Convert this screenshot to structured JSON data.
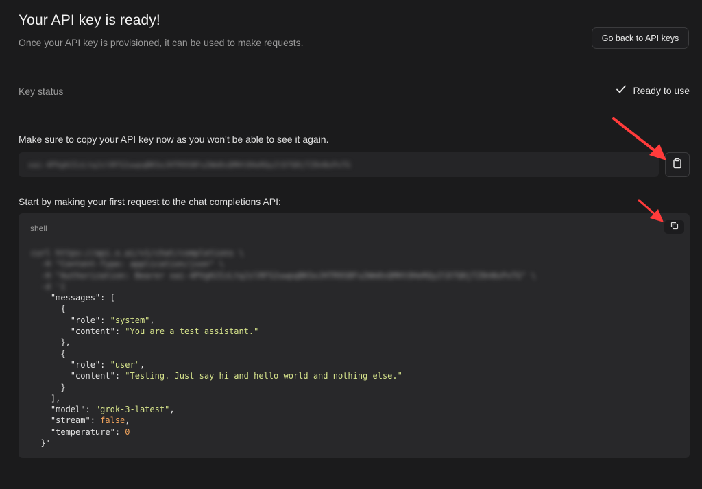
{
  "header": {
    "title": "Your API key is ready!",
    "subtitle": "Once your API key is provisioned, it can be used to make requests.",
    "back_button": "Go back to API keys"
  },
  "status": {
    "label": "Key status",
    "value": "Ready to use",
    "icon": "check-icon"
  },
  "key_section": {
    "notice": "Make sure to copy your API key now as you won't be able to see it again.",
    "key_value_obscured": "xai-4PVgHJIzLtqJzlRFS2uwpqBKSoJHTR9SBFu2Wm8sQMHtOHeRQy2lD7Q0jTZ0nNsPxTG",
    "copy_icon": "clipboard-icon"
  },
  "request_section": {
    "intro": "Start by making your first request to the chat completions API:",
    "language": "shell",
    "copy_icon": "copy-icon",
    "obscured_lines": [
      "curl https://api.x.ai/v1/chat/completions \\",
      "  -H \"Content-Type: application/json\" \\",
      "  -H \"Authorization: Bearer xai-4PVgHJIzLtqJzlRFS2uwpqBKSoJHTR9SBFu2Wm8sQMHtOHeRQy2lD7Q0jTZ0nNsPxTG\" \\",
      "  -d '{"
    ],
    "code": {
      "messages_key": "\"messages\"",
      "role_key": "\"role\"",
      "content_key": "\"content\"",
      "system_role": "\"system\"",
      "system_content": "\"You are a test assistant.\"",
      "user_role": "\"user\"",
      "user_content": "\"Testing. Just say hi and hello world and nothing else.\"",
      "model_key": "\"model\"",
      "model_value": "\"grok-3-latest\"",
      "stream_key": "\"stream\"",
      "stream_value": "false",
      "temperature_key": "\"temperature\"",
      "temperature_value": "0",
      "closing": "}'"
    }
  },
  "colors": {
    "background": "#1b1b1c",
    "code_background": "#28282a",
    "string": "#d6e38b",
    "literal": "#f0a35c",
    "arrow": "#ff3b3b"
  }
}
